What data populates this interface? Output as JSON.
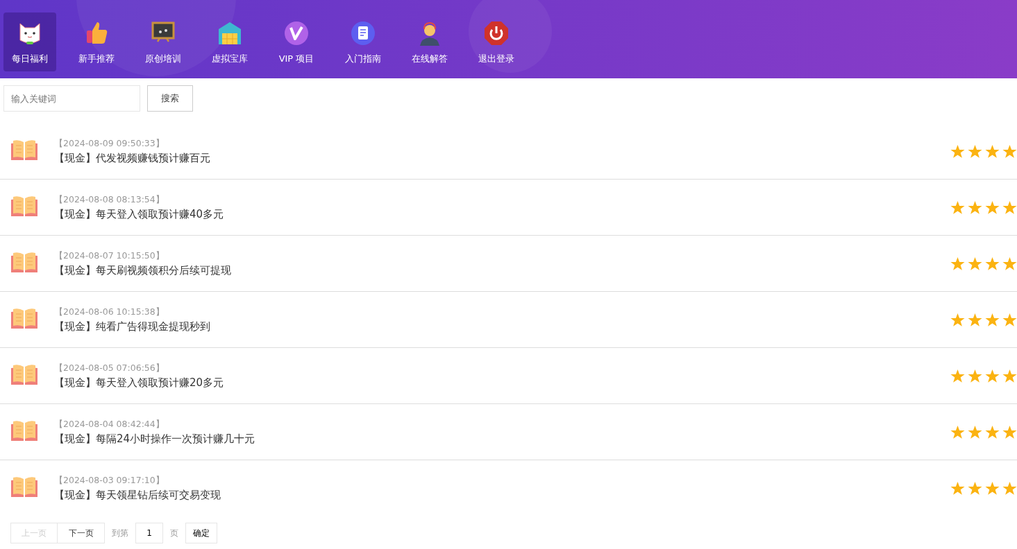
{
  "nav": [
    {
      "label": "每日福利",
      "kind": "cat",
      "selected": true
    },
    {
      "label": "新手推荐",
      "kind": "thumb",
      "selected": false
    },
    {
      "label": "原创培训",
      "kind": "board",
      "selected": false
    },
    {
      "label": "虚拟宝库",
      "kind": "warehouse",
      "selected": false
    },
    {
      "label": "VIP 项目",
      "kind": "vip",
      "selected": false
    },
    {
      "label": "入门指南",
      "kind": "guide",
      "selected": false
    },
    {
      "label": "在线解答",
      "kind": "support",
      "selected": false
    },
    {
      "label": "退出登录",
      "kind": "power",
      "selected": false
    }
  ],
  "search": {
    "placeholder": "输入关键词",
    "button": "搜索"
  },
  "items": [
    {
      "time": "【2024-08-09 09:50:33】",
      "title": "【现金】代发视频赚钱预计赚百元",
      "stars": 4
    },
    {
      "time": "【2024-08-08 08:13:54】",
      "title": "【现金】每天登入领取预计赚40多元",
      "stars": 4
    },
    {
      "time": "【2024-08-07 10:15:50】",
      "title": "【现金】每天刷视频领积分后续可提现",
      "stars": 4
    },
    {
      "time": "【2024-08-06 10:15:38】",
      "title": "【现金】纯看广告得现金提现秒到",
      "stars": 4
    },
    {
      "time": "【2024-08-05 07:06:56】",
      "title": "【现金】每天登入领取预计赚20多元",
      "stars": 4
    },
    {
      "time": "【2024-08-04 08:42:44】",
      "title": "【现金】每隔24小时操作一次预计赚几十元",
      "stars": 4
    },
    {
      "time": "【2024-08-03 09:17:10】",
      "title": "【现金】每天领星钻后续可交易变现",
      "stars": 4
    }
  ],
  "pager": {
    "prev": {
      "label": "上一页",
      "disabled": true
    },
    "next": {
      "label": "下一页",
      "disabled": false
    },
    "goto_label": "到第",
    "page": "1",
    "page_unit": "页",
    "confirm": "确定"
  }
}
